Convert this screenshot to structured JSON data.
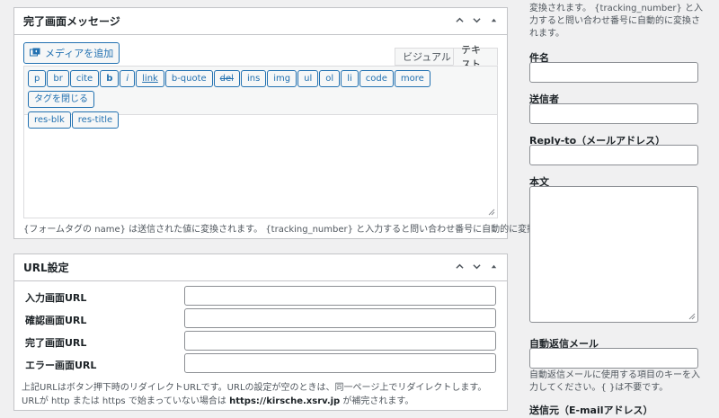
{
  "complete_panel": {
    "title": "完了画面メッセージ",
    "media_button": "メディアを追加",
    "tab_visual": "ビジュアル",
    "tab_text": "テキスト",
    "quicktags": [
      "p",
      "br",
      "cite",
      "b",
      "i",
      "link",
      "b-quote",
      "del",
      "ins",
      "img",
      "ul",
      "ol",
      "li",
      "code",
      "more",
      "タグを閉じる",
      "res-blk",
      "res-title"
    ],
    "help": "{フォームタグの name} は送信された値に変換されます。 {tracking_number} と入力すると問い合わせ番号に自動的に変換されます。"
  },
  "url_panel": {
    "title": "URL設定",
    "rows": [
      {
        "label": "入力画面URL"
      },
      {
        "label": "確認画面URL"
      },
      {
        "label": "完了画面URL"
      },
      {
        "label": "エラー画面URL"
      }
    ],
    "note1": "上記URLはボタン押下時のリダイレクトURLです。URLの設定が空のときは、同一ページ上でリダイレクトします。",
    "note2_prefix": "URLが http または https で始まっていない場合は",
    "note2_url": "https://kirsche.xsrv.jp",
    "note2_suffix": "が補完されます。"
  },
  "sidebar": {
    "top_text": "変換されます。 {tracking_number} と入力すると問い合わせ番号に自動的に変換されます。",
    "subject_label": "件名",
    "sender_label": "送信者",
    "replyto_label": "Reply-to（メールアドレス）",
    "body_label": "本文",
    "autoreply_label": "自動返信メール",
    "autoreply_help": "自動返信メールに使用する項目のキーを入力してください。{ }は不要です。",
    "from_label": "送信元（E-mailアドレス）"
  }
}
